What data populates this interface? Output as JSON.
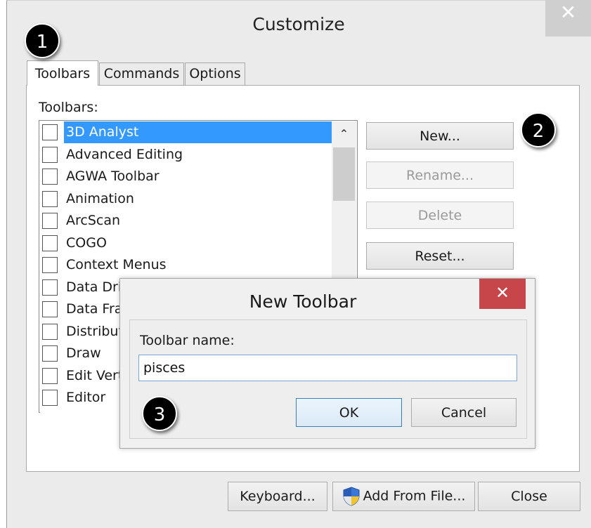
{
  "customize": {
    "title": "Customize",
    "close_glyph": "✕",
    "tabs": [
      {
        "label": "Toolbars",
        "active": true
      },
      {
        "label": "Commands",
        "active": false
      },
      {
        "label": "Options",
        "active": false
      }
    ],
    "toolbars_label": "Toolbars:",
    "toolbar_items": [
      {
        "label": "3D Analyst",
        "checked": false,
        "selected": true
      },
      {
        "label": "Advanced Editing",
        "checked": false
      },
      {
        "label": "AGWA Toolbar",
        "checked": false
      },
      {
        "label": "Animation",
        "checked": false
      },
      {
        "label": "ArcScan",
        "checked": false
      },
      {
        "label": "COGO",
        "checked": false
      },
      {
        "label": "Context Menus",
        "checked": false
      },
      {
        "label": "Data Dri",
        "checked": false
      },
      {
        "label": "Data Fra",
        "checked": false
      },
      {
        "label": "Distribut",
        "checked": false
      },
      {
        "label": "Draw",
        "checked": false
      },
      {
        "label": "Edit Vert",
        "checked": false
      },
      {
        "label": "Editor",
        "checked": false
      }
    ],
    "buttons": {
      "new": "New...",
      "rename": "Rename...",
      "delete": "Delete",
      "reset": "Reset...",
      "keyboard": "Keyboard...",
      "add_from_file": "Add From File...",
      "close": "Close"
    }
  },
  "new_toolbar_dialog": {
    "title": "New Toolbar",
    "close_glyph": "✕",
    "name_label": "Toolbar name:",
    "name_value": "pisces",
    "ok": "OK",
    "cancel": "Cancel"
  },
  "callouts": [
    "1",
    "2",
    "3"
  ],
  "colors": {
    "selection": "#3399ff",
    "close_red": "#c7464a",
    "dialog_bg": "#ebebeb"
  },
  "icons": {
    "add_from_file": "uac-shield-icon",
    "scroll_up": "chevron-up-icon"
  }
}
